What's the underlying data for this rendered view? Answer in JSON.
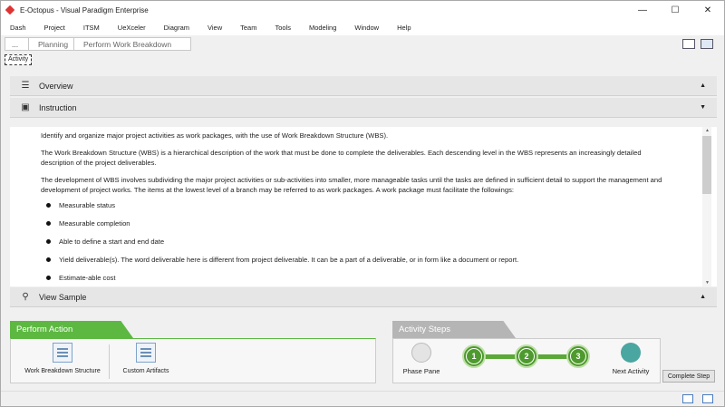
{
  "window": {
    "title": "E-Octopus - Visual Paradigm Enterprise",
    "minimize": "—",
    "maximize": "☐",
    "close": "✕"
  },
  "menu": [
    "Dash",
    "Project",
    "ITSM",
    "UeXceler",
    "Diagram",
    "View",
    "Team",
    "Tools",
    "Modeling",
    "Window",
    "Help"
  ],
  "breadcrumb": {
    "more": "...",
    "items": [
      "Planning",
      "Perform Work Breakdown"
    ]
  },
  "activity_tab": "Activity",
  "sections": {
    "overview": "Overview",
    "instruction": "Instruction",
    "view_sample": "View Sample"
  },
  "instruction": {
    "paragraphs": [
      "Identify and organize major project activities as work packages, with the use of Work Breakdown Structure (WBS).",
      "The Work Breakdown Structure (WBS) is a hierarchical description of the work that must be done to complete the deliverables. Each descending level in the WBS represents an increasingly detailed description of the project deliverables.",
      "The development of WBS involves subdividing the major project activities or sub-activities into smaller, more manageable tasks until the tasks are defined in sufficient detail to support the management and development of project works. The items at the lowest level of a branch may be referred to as work packages. A work package must facilitate the followings:"
    ],
    "bullets": [
      "Measurable status",
      "Measurable completion",
      "Able to define a start and end date",
      "Yield deliverable(s). The word deliverable here is different from project deliverable. It can be a part of a deliverable, or in form like a document or report.",
      "Estimate-able cost"
    ]
  },
  "perform_action": {
    "header": "Perform Action",
    "actions": [
      "Work Breakdown Structure",
      "Custom Artifacts"
    ]
  },
  "activity_steps": {
    "header": "Activity Steps",
    "phase_pane": "Phase Pane",
    "steps": [
      "1",
      "2",
      "3"
    ],
    "next_activity": "Next Activity",
    "complete_step": "Complete Step"
  },
  "colors": {
    "perform_green": "#5db842",
    "step_green": "#4e9a2e",
    "steps_gray": "#b5b5b5"
  }
}
